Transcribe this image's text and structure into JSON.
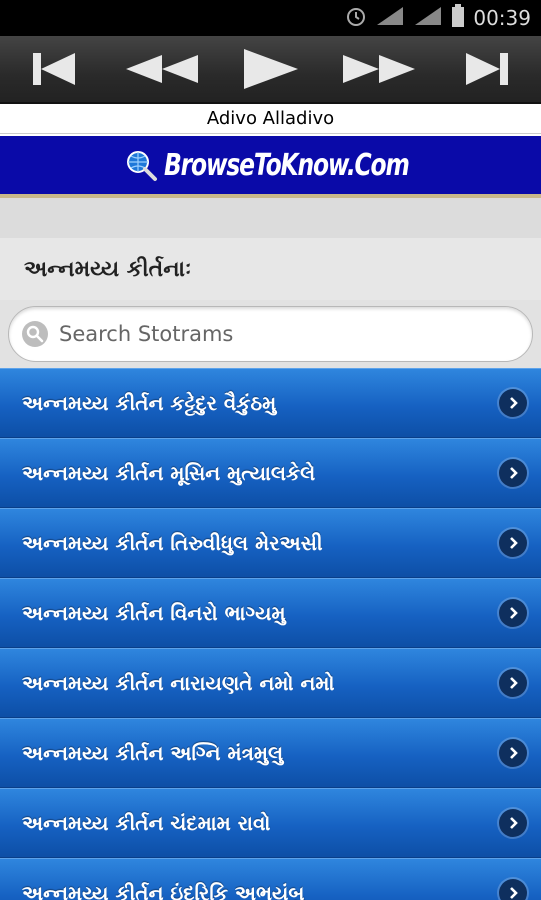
{
  "status": {
    "time": "00:39"
  },
  "player": {
    "buttons": [
      "previous-icon",
      "rewind-icon",
      "play-icon",
      "fast-forward-icon",
      "next-icon"
    ]
  },
  "app_title": "Adivo Alladivo",
  "banner": {
    "text": "BrowseToKnow.Com",
    "icon": "globe-search-icon"
  },
  "heading": "અન્નમય્ય કીર્તનાઃ",
  "search": {
    "placeholder": "Search Stotrams",
    "value": ""
  },
  "items": [
    {
      "label": "અન્નમય્ય કીર્તન કટ્ટેદુર વૈકુંઠમુ"
    },
    {
      "label": "અન્નમય્ય કીર્તન મૂસિન મુત્યાલકેલે"
    },
    {
      "label": "અન્નમય્ય કીર્તન તિરુવીધુલ મેરઅસી"
    },
    {
      "label": "અન્નમય્ય કીર્તન વિનરો ભાગ્યમુ"
    },
    {
      "label": "અન્નમય્ય કીર્તન નારાયણતે નમો નમો"
    },
    {
      "label": "અન્નમય્ય કીર્તન અગ્નિ મંત્રમુલુ"
    },
    {
      "label": "અન્નમય્ય કીર્તન ચંદમામ રાવો"
    },
    {
      "label": "અન્નમય્ય કીર્તન ઇંદરિકિ અભયંબુ"
    }
  ],
  "colors": {
    "banner": "#0a0aa8",
    "list_item": "#1661c2"
  }
}
